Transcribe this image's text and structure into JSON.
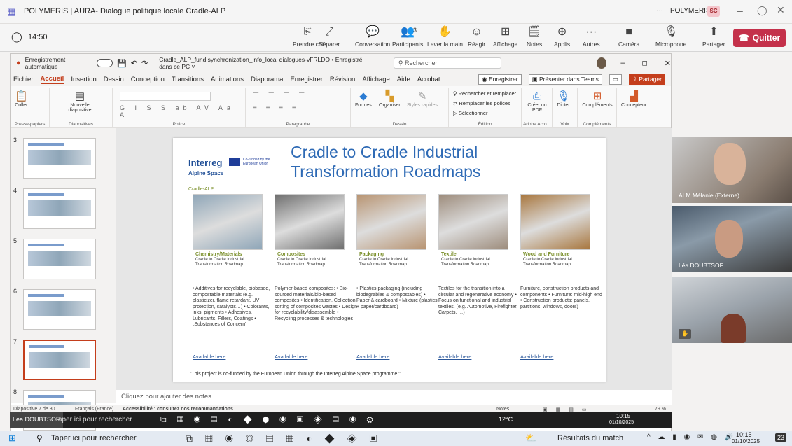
{
  "teams": {
    "title": "POLYMERIS | AURA- Dialogue politique locale Cradle-ALP",
    "timer": "14:50",
    "org": "POLYMERIS",
    "avatar": "SC",
    "win_more": "···",
    "toolbar": [
      {
        "label": "Prendre ctrl",
        "icon": "⎘"
      },
      {
        "label": "Séparer",
        "icon": "⤢"
      },
      {
        "label": "Conversation",
        "icon": "💬"
      },
      {
        "label": "Participants",
        "icon": "👥",
        "count": "3"
      },
      {
        "label": "Lever la main",
        "icon": "✋"
      },
      {
        "label": "Réagir",
        "icon": "☺"
      },
      {
        "label": "Affichage",
        "icon": "⊞"
      },
      {
        "label": "Notes",
        "icon": "🗒"
      },
      {
        "label": "Applis",
        "icon": "⊕"
      },
      {
        "label": "Autres",
        "icon": "···"
      },
      {
        "label": "Caméra",
        "icon": "■"
      },
      {
        "label": "Microphone",
        "icon": "🎙"
      },
      {
        "label": "Partager",
        "icon": "⬆"
      }
    ],
    "quit": "Quitter"
  },
  "ppt": {
    "autosave": "Enregistrement automatique",
    "file": "Cradle_ALP_fund synchronization_info_local dialogues-vFRLDO • Enregistré dans ce PC ˅",
    "search": "Rechercher",
    "menu": [
      "Fichier",
      "Accueil",
      "Insertion",
      "Dessin",
      "Conception",
      "Transitions",
      "Animations",
      "Diaporama",
      "Enregistrer",
      "Révision",
      "Affichage",
      "Aide",
      "Acrobat"
    ],
    "btn_save": "Enregistrer",
    "btn_teams": "Présenter dans Teams",
    "btn_share": "Partager",
    "ribbon": {
      "coller": "Coller",
      "nouvelle": "Nouvelle diapositive",
      "formes": "Formes",
      "organiser": "Organiser",
      "styles": "Styles rapides",
      "rechercher": "Rechercher et remplacer",
      "remplacer": "Remplacer les polices",
      "selectionner": "Sélectionner",
      "creer": "Créer un PDF",
      "dicter": "Dicter",
      "complements": "Compléments",
      "concepteur": "Concepteur",
      "groups": [
        "Presse-papiers",
        "Diapositives",
        "Police",
        "Paragraphe",
        "Dessin",
        "Édition",
        "Adobe Acro...",
        "Voix",
        "Compléments"
      ]
    },
    "thumb_numbers": [
      "3",
      "4",
      "5",
      "6",
      "7",
      "8"
    ],
    "notes": "Cliquez pour ajouter des notes",
    "status": {
      "slide": "Diapositive 7 de 30",
      "lang": "Français (France)",
      "access": "Accessibilité : consultez nos recommandations",
      "notes": "Notes",
      "zoom": "79 %"
    }
  },
  "slide": {
    "brand": "Interreg",
    "brand_sub": "Alpine Space",
    "eu": "Co-funded by the European Union",
    "tag": "Cradle-ALP",
    "title1": "Cradle to Cradle Industrial",
    "title2": "Transformation Roadmaps",
    "columns": [
      {
        "cap": "Chemistry/Materials",
        "sub": "Cradle to Cradle Industrial Transformation Roadmap",
        "text": "• Additives for recyclable, biobased, compostable materials (e.g. plasticizer, flame retardant, UV protection, catalysts…) • Colorants, inks, pigments • Adhesives, Lubricants, Fillers, Coatings • „Substances of Concern'",
        "link": "Available here",
        "color": "#8fa6b8"
      },
      {
        "cap": "Composites",
        "sub": "Cradle to Cradle Industrial Transformation Roadmap",
        "text": "Polymer-based composites: • Bio-sourced materials/bio-based composites • Identification, Collection, sorting of composites wastes • Design for recyclability/disassemble • Recycling processes & technologies",
        "link": "Available here",
        "color": "#6f6f6f"
      },
      {
        "cap": "Packaging",
        "sub": "Cradle to Cradle Industrial Transformation Roadmap",
        "text": "• Plastics packaging (including biodegrables & compostables) • Paper & cardboard • Mixture (plastics + paper/cardboard)",
        "link": "Available here",
        "color": "#b89472"
      },
      {
        "cap": "Textile",
        "sub": "Cradle to Cradle Industrial Transformation Roadmap",
        "text": "Textiles for the transition into a circular and regenerative economy • Focus on functional and industrial textiles. (e.g. Automotive, Firefighter, Carpets, …)",
        "link": "Available here",
        "color": "#9d8c7c"
      },
      {
        "cap": "Wood and Furniture",
        "sub": "Cradle to Cradle Industrial Transformation Roadmap",
        "text": "Furniture, construction products and components • Furniture: mid-high end • Construction products: panels, partitions, windows, doors)",
        "link": "Available here",
        "color": "#a8773f"
      }
    ],
    "footer": "\"This project is co-funded by the European Union through the Interreg Alpine Space programme.\""
  },
  "participants": [
    {
      "name": "ALM Mélanie (Externe)"
    },
    {
      "name": "Léa DOUBTSOF"
    },
    {
      "name": ""
    }
  ],
  "taskbar1": {
    "user": "Léa DOUBTSOF",
    "search": "Taper ici pour rechercher",
    "temp": "12°C",
    "time": "10:15",
    "date": "01/10/2025"
  },
  "taskbar2": {
    "search": "Taper ici pour rechercher",
    "news": "Résultats du match",
    "time": "10:15",
    "date": "01/10/2025",
    "badge": "23"
  }
}
